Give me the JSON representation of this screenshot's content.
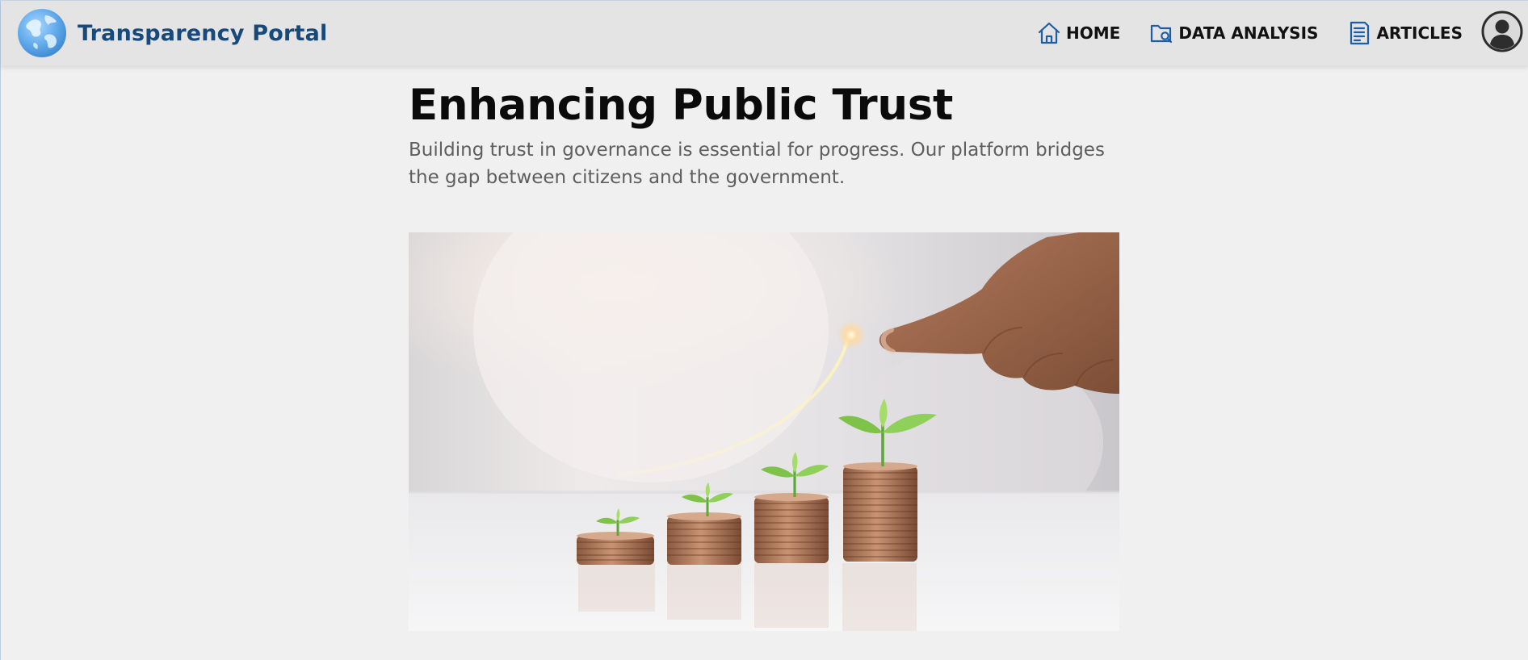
{
  "header": {
    "brand_name": "Transparency Portal",
    "logo_icon": "globe-icon",
    "nav": [
      {
        "label": "HOME",
        "icon": "home-icon"
      },
      {
        "label": "DATA ANALYSIS",
        "icon": "folder-search-icon"
      },
      {
        "label": "ARTICLES",
        "icon": "document-icon"
      }
    ],
    "profile_icon": "user-avatar-icon"
  },
  "main": {
    "title": "Enhancing Public Trust",
    "subtitle": "Building trust in governance is essential for progress. Our platform bridges the gap between citizens and the government.",
    "hero_image": "coin-stacks-with-seedlings-growth-arrow"
  },
  "colors": {
    "brand": "#17497a",
    "nav_icon": "#1d5ea6",
    "header_bg": "#e4e4e4",
    "page_bg": "#f0f0f0"
  }
}
